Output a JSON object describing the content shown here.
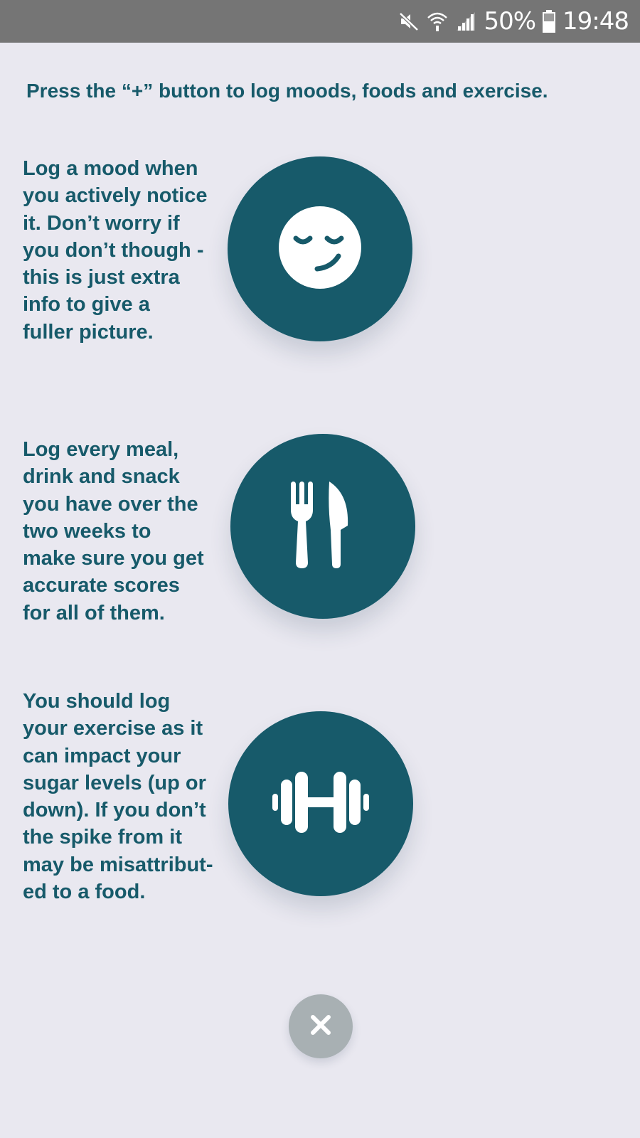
{
  "status_bar": {
    "battery": "50%",
    "time": "19:48",
    "icons": [
      "mute-icon",
      "wifi-icon",
      "signal-icon",
      "battery-icon"
    ]
  },
  "intro": "Press the “+” button to log moods, foods and exercise.",
  "rows": [
    {
      "icon": "mood-face-icon",
      "lines": [
        "Log a mood when",
        "you actively notice",
        "it. Don’t worry if",
        "you don’t though -",
        "this is just extra",
        "info to give a",
        "fuller picture."
      ]
    },
    {
      "icon": "fork-knife-icon",
      "lines": [
        "Log every meal,",
        "drink and snack",
        "you have over the",
        "two weeks to",
        "make sure you get",
        "accurate scores",
        "for all of them."
      ]
    },
    {
      "icon": "dumbbell-icon",
      "lines": [
        "You should log",
        "your exercise as it",
        "can impact your",
        "sugar levels (up or",
        "down). If you don’t",
        "the spike from it",
        "may be misattribut-",
        "ed to a food."
      ]
    }
  ],
  "close_icon": "close-icon",
  "colors": {
    "background": "#e9e8f0",
    "accent": "#175a6a",
    "status_bar": "#757575",
    "close_button": "#a8b0b3"
  }
}
